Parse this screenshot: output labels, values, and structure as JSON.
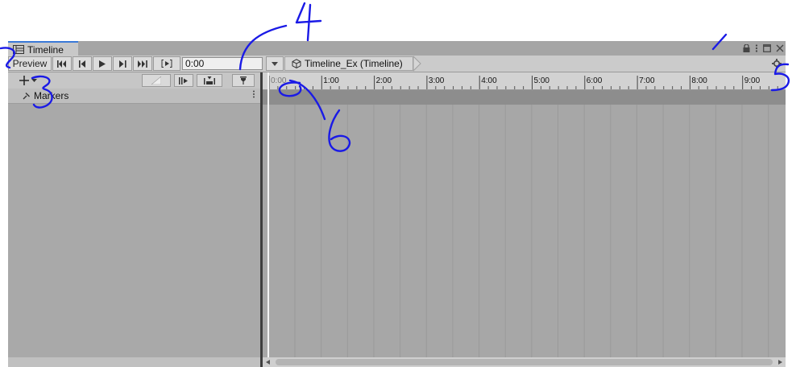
{
  "window": {
    "tab_title": "Timeline",
    "tab_icon": "timeline-icon",
    "controls": [
      "lock-icon",
      "more-vert-icon",
      "maximize-icon",
      "close-icon"
    ]
  },
  "toolbar": {
    "preview_label": "Preview",
    "playback_buttons": [
      "go-to-start-icon",
      "previous-frame-icon",
      "play-icon",
      "next-frame-icon",
      "go-to-end-icon",
      "play-range-icon"
    ],
    "time_value": "0:00",
    "breadcrumb_label": "Timeline_Ex (Timeline)",
    "breadcrumb_icon": "cube-icon",
    "settings_icon": "gear-icon"
  },
  "track_toolbar": {
    "add_icon": "plus-icon",
    "buttons": [
      "clip-edit-mode-icon",
      "ripple-mode-icon",
      "replace-mode-icon",
      "snap-icon"
    ]
  },
  "markers": {
    "label": "Markers",
    "icon": "pin-icon"
  },
  "ruler": {
    "labels": [
      "0:00",
      "1:00",
      "2:00",
      "3:00",
      "4:00",
      "5:00",
      "6:00",
      "7:00",
      "8:00",
      "9:00"
    ]
  },
  "annotations": [
    "1",
    "2",
    "3",
    "4",
    "5",
    "6"
  ],
  "colors": {
    "accent": "#3a79d7",
    "annotation_ink": "#1a1ae6",
    "panel": "#a9a9a9",
    "divider": "#3e3e3e"
  }
}
